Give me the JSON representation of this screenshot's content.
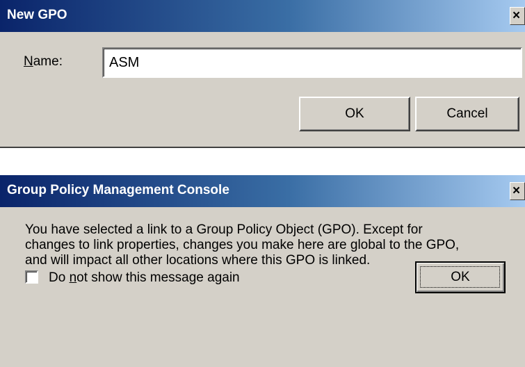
{
  "new_gpo_dialog": {
    "title": "New GPO",
    "close_glyph": "×",
    "name_label_underlined": "N",
    "name_label_rest": "ame:",
    "name_value": "ASM",
    "ok_label": "OK",
    "cancel_label": "Cancel"
  },
  "gpmc_dialog": {
    "title": "Group Policy Management Console",
    "close_glyph": "×",
    "message_lines": [
      "You have selected a link to a Group Policy Object (GPO). Except for",
      "changes to link properties, changes you make here are global to the GPO,",
      "and will impact all other locations where this GPO is linked."
    ],
    "checkbox_label_pre": "Do ",
    "checkbox_label_underlined": "n",
    "checkbox_label_post": "ot show this message again",
    "checkbox_checked": false,
    "ok_label": "OK"
  },
  "colors": {
    "titlebar_start": "#0a246a",
    "titlebar_end": "#a6caf0",
    "dialog_face": "#d4d0c8"
  }
}
